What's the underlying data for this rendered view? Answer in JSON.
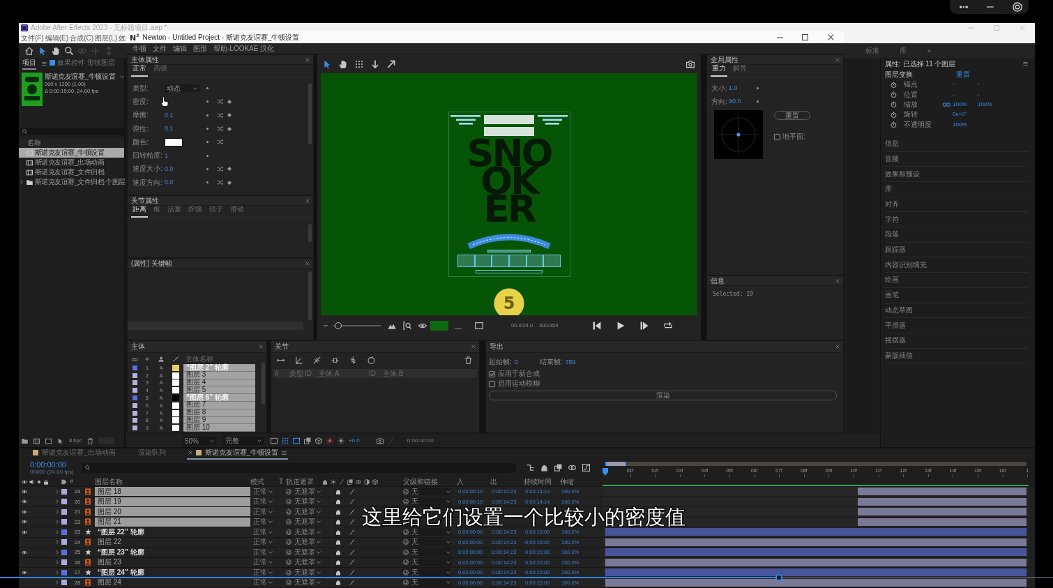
{
  "video_player": {
    "progress": {
      "level": 0.74
    }
  },
  "ae": {
    "title": "Adobe After Effects 2023 - 无标题项目.aep *",
    "menu": [
      "文件(F)",
      "编辑(E)",
      "合成(C)",
      "图层(L)",
      "效"
    ],
    "tools": [
      {
        "kind": "home",
        "selected": false,
        "disabled": false
      },
      {
        "kind": "select",
        "selected": true,
        "disabled": false
      },
      {
        "kind": "hand",
        "selected": false,
        "disabled": false
      },
      {
        "kind": "zoom",
        "selected": false,
        "disabled": false
      },
      {
        "kind": "orbit",
        "selected": false,
        "disabled": true
      },
      {
        "kind": "move",
        "selected": false,
        "disabled": true
      },
      {
        "kind": "dolly",
        "selected": false,
        "disabled": true
      }
    ],
    "workspaces": [
      {
        "label": "标准",
        "selected": false
      },
      {
        "label": "库",
        "selected": false
      }
    ],
    "workspace_more": "»",
    "project": {
      "tabs": [
        {
          "label": "项目",
          "selected": true
        },
        {
          "label": "效果控件 形状图层",
          "selected": false
        }
      ],
      "comp": {
        "name": "斯诺克友谊赛_牛顿设置",
        "size": "900 x 1200 (1.00)",
        "duration": "Δ 0:00:15:00, 24.00 fps"
      },
      "column": "名称",
      "items": [
        {
          "kind": "comp",
          "name": "斯诺克友谊赛_牛顿设置",
          "selected": true
        },
        {
          "kind": "comp",
          "name": "斯诺克友谊赛_出场动画",
          "selected": false
        },
        {
          "kind": "comp",
          "name": "斯诺克友谊赛_文件归档",
          "selected": false
        },
        {
          "kind": "folder",
          "name": "斯诺克友谊赛_文件归档 个图层",
          "selected": false
        }
      ],
      "bpc": "8 bpc"
    },
    "viewer_footer": {
      "zoom": "50%",
      "resolution": "完整",
      "exposure": "+0.0",
      "time": "0:00:00:00"
    },
    "properties": {
      "title": "属性: 已选择 11 个图层",
      "group": "图层变换",
      "reset": "重置",
      "rows": [
        {
          "label": "锚点",
          "linked": false,
          "values": [
            "-",
            "-"
          ]
        },
        {
          "label": "位置",
          "linked": false,
          "values": [
            "-",
            "-"
          ]
        },
        {
          "label": "缩放",
          "linked": true,
          "values": [
            "100%",
            "100%"
          ]
        },
        {
          "label": "旋转",
          "linked": false,
          "values": [
            "0x+0°"
          ]
        },
        {
          "label": "不透明度",
          "linked": false,
          "values": [
            "100%"
          ]
        }
      ],
      "panels": [
        "信息",
        "音频",
        "效果和预设",
        "库",
        "对齐",
        "字符",
        "段落",
        "跟踪器",
        "内容识别填充",
        "绘画",
        "画笔",
        "动态草图",
        "平滑器",
        "摇摆器",
        "蒙版插值"
      ]
    },
    "timeline": {
      "tabs": [
        {
          "label": "斯诺克友谊赛_出场动画",
          "selected": false,
          "kind": "comp"
        },
        {
          "label": "渲染队列",
          "selected": false,
          "kind": "queue"
        },
        {
          "label": "斯诺克友谊赛_牛顿设置",
          "selected": true,
          "kind": "comp"
        }
      ],
      "time": "0:00:00:00",
      "frame_info": "00000 (24.00 fps)",
      "columns": {
        "number": "#",
        "name": "图层名称",
        "mode": "模式",
        "t": "T",
        "matte": "轨道遮罩",
        "parent": "父级和链接",
        "in": "入",
        "out": "出",
        "duration": "持续时间",
        "stretch": "伸缩"
      },
      "ruler": [
        "01f",
        "02f",
        "03f",
        "04f",
        "05f",
        "06f",
        "07f",
        "08f",
        "09f",
        "10f",
        "11f",
        "12f",
        "13f",
        "14f",
        "15f",
        "16f",
        "1"
      ],
      "layers": [
        {
          "num": "19",
          "kind": "vector",
          "name": "图层 18",
          "selected": true,
          "visible": true,
          "color": "#a9aadc",
          "mode": "正常",
          "matte": "无遮罩",
          "parent": "无",
          "in": "0:00:00:10",
          "out": "0:00:14:23",
          "duration": "0:00:14:14",
          "stretch": "100.0%",
          "bar": {
            "level": 0.4
          }
        },
        {
          "num": "20",
          "kind": "vector",
          "name": "图层 19",
          "selected": true,
          "visible": true,
          "color": "#a9aadc",
          "mode": "正常",
          "matte": "无遮罩",
          "parent": "无",
          "in": "0:00:00:10",
          "out": "0:00:14:23",
          "duration": "0:00:14:14",
          "stretch": "100.0%",
          "bar": {
            "level": 0.4
          }
        },
        {
          "num": "21",
          "kind": "vector",
          "name": "图层 20",
          "selected": true,
          "visible": true,
          "color": "#a9aadc",
          "mode": "正常",
          "matte": "无遮罩",
          "bar": {
            "level": 0.4
          }
        },
        {
          "num": "22",
          "kind": "vector",
          "name": "图层 21",
          "selected": true,
          "visible": true,
          "color": "#a9aadc",
          "mode": "正常",
          "matte": "无遮罩",
          "bar": {
            "level": 0.4
          }
        },
        {
          "num": "23",
          "kind": "shape",
          "name": "“图层 22” 轮廓",
          "selected": false,
          "visible": true,
          "color": "#5b6fe0",
          "mode": "正常",
          "matte": "无遮罩",
          "parent": "无",
          "in": "0:00:00:00",
          "out": "0:00:14:23",
          "duration": "0:00:15:00",
          "stretch": "100.0%",
          "bar": {
            "level": 1
          }
        },
        {
          "num": "24",
          "kind": "vector",
          "name": "图层 22",
          "selected": false,
          "visible": false,
          "color": "#a9aadc",
          "mode": "正常",
          "matte": "无遮罩",
          "parent": "无",
          "in": "0:00:00:00",
          "out": "0:00:14:23",
          "duration": "0:00:15:00",
          "stretch": "100.0%",
          "bar": {
            "level": 1
          }
        },
        {
          "num": "25",
          "kind": "shape",
          "name": "“图层 23” 轮廓",
          "selected": false,
          "visible": true,
          "color": "#5b6fe0",
          "mode": "正常",
          "matte": "无遮罩",
          "parent": "无",
          "in": "0:00:00:00",
          "out": "0:00:14:23",
          "duration": "0:00:15:00",
          "stretch": "100.0%",
          "bar": {
            "level": 1
          }
        },
        {
          "num": "26",
          "kind": "vector",
          "name": "图层 23",
          "selected": false,
          "visible": false,
          "color": "#a9aadc",
          "mode": "正常",
          "matte": "无遮罩",
          "parent": "无",
          "in": "0:00:00:00",
          "out": "0:00:14:23",
          "duration": "0:00:15:00",
          "stretch": "100.0%",
          "bar": {
            "level": 1
          }
        },
        {
          "num": "27",
          "kind": "shape",
          "name": "“图层 24” 轮廓",
          "selected": false,
          "visible": true,
          "color": "#5b6fe0",
          "mode": "正常",
          "matte": "无遮罩",
          "parent": "无",
          "in": "0:00:00:00",
          "out": "0:00:14:23",
          "duration": "0:00:15:00",
          "stretch": "100.0%",
          "bar": {
            "level": 1
          }
        },
        {
          "num": "28",
          "kind": "vector",
          "name": "图层 24",
          "selected": false,
          "visible": false,
          "color": "#a9aadc",
          "mode": "正常",
          "matte": "无遮罩",
          "parent": "无",
          "in": "0:00:00:00",
          "out": "0:00:14:23",
          "duration": "0:00:15:00",
          "stretch": "100.0%",
          "bar": {
            "level": 1
          }
        }
      ]
    }
  },
  "newton": {
    "logo": "N$^{3}$",
    "title": "Newton - Untitled Project - 斯诺克友谊赛_牛顿设置",
    "menu": [
      "牛顿",
      "文件",
      "编辑",
      "图形",
      "帮助-LOOKAE 汉化"
    ],
    "body_props": {
      "title": "主体属性",
      "tabs": [
        {
          "label": "正常",
          "selected": true
        },
        {
          "label": "高级",
          "selected": false
        }
      ],
      "rows": [
        {
          "kind": "dropdown",
          "label": "类型:",
          "value": "动态",
          "shuffle": false,
          "keyframe": false
        },
        {
          "kind": "number",
          "label": "密度:",
          "shuffle": true,
          "keyframe": true
        },
        {
          "kind": "number",
          "label": "摩擦:",
          "value": "0.1",
          "shuffle": true,
          "keyframe": true
        },
        {
          "kind": "number",
          "label": "弹性:",
          "value": "0.1",
          "shuffle": true,
          "keyframe": true
        },
        {
          "kind": "color",
          "label": "颜色:",
          "color": "#ffffff",
          "shuffle": true,
          "keyframe": false
        },
        {
          "kind": "number",
          "label": "回转精度:",
          "value": "1",
          "shuffle": false,
          "keyframe": false
        },
        {
          "kind": "number",
          "label": "速度大小:",
          "value": "0.0",
          "shuffle": true,
          "keyframe": true
        },
        {
          "kind": "number",
          "label": "速度方向:",
          "value": "0.0",
          "shuffle": true,
          "keyframe": true
        }
      ]
    },
    "joint_props": {
      "title": "关节属性",
      "tabs": [
        {
          "label": "距离",
          "selected": true
        },
        {
          "label": "枢",
          "selected": false
        },
        {
          "label": "活塞",
          "selected": false
        },
        {
          "label": "焊接",
          "selected": false
        },
        {
          "label": "轮子",
          "selected": false
        },
        {
          "label": "滑动",
          "selected": false
        }
      ]
    },
    "keyframes": {
      "title": "(属性) 关键帧"
    },
    "viewer": {
      "tools": [
        {
          "kind": "select",
          "selected": true
        },
        {
          "kind": "hand",
          "selected": false
        },
        {
          "kind": "grid",
          "selected": false
        },
        {
          "kind": "pin",
          "selected": false
        },
        {
          "kind": "arrow",
          "selected": false
        }
      ],
      "poster": {
        "lines": [
          "SNO",
          "OK",
          "ER"
        ],
        "ball": "5"
      },
      "zoom": {
        "level": 0.1
      },
      "fps": "00.0/24.0",
      "frame": "000/359"
    },
    "global_props": {
      "title": "全局属性",
      "tabs": [
        {
          "label": "重力",
          "selected": true
        },
        {
          "label": "解算",
          "selected": false
        }
      ],
      "rows": [
        {
          "label": "大小:",
          "value": "1.0"
        },
        {
          "label": "方向:",
          "value": "90.0"
        }
      ],
      "reset": "重置",
      "checkbox": {
        "label": "地平面:",
        "checked": false
      }
    },
    "info": {
      "title": "信息",
      "text": "Selected: 19"
    },
    "bodies": {
      "title": "主体",
      "columns": {
        "number": "#",
        "name": "主体名称"
      },
      "rows": [
        {
          "num": "1",
          "label": {
            "color": "#5b6fe0"
          },
          "group": "A",
          "color": "#e6d35a",
          "kind": "shape",
          "name": "“图层 2” 轮廓",
          "selected": true
        },
        {
          "num": "2",
          "label": {
            "color": "#b3b4de"
          },
          "group": "A",
          "color": "#ffffff",
          "kind": "vector",
          "name": "图层 3",
          "selected": true
        },
        {
          "num": "3",
          "label": {
            "color": "#b3b4de"
          },
          "group": "A",
          "color": "#ffffff",
          "kind": "vector",
          "name": "图层 4",
          "selected": true
        },
        {
          "num": "4",
          "label": {
            "color": "#b3b4de"
          },
          "group": "A",
          "color": "#ffffff",
          "kind": "vector",
          "name": "图层 5",
          "selected": true
        },
        {
          "num": "5",
          "label": {
            "color": "#5b6fe0"
          },
          "group": "A",
          "color": "#000000",
          "kind": "shape",
          "name": "“图层 6” 轮廓",
          "selected": true
        },
        {
          "num": "6",
          "label": {
            "color": "#b3b4de"
          },
          "group": "A",
          "color": "#ffffff",
          "kind": "vector",
          "name": "图层 7",
          "selected": true
        },
        {
          "num": "7",
          "label": {
            "color": "#b3b4de"
          },
          "group": "A",
          "color": "#ffffff",
          "kind": "vector",
          "name": "图层 8",
          "selected": true
        },
        {
          "num": "8",
          "label": {
            "color": "#b3b4de"
          },
          "group": "A",
          "color": "#ffffff",
          "kind": "vector",
          "name": "图层 9",
          "selected": true
        },
        {
          "num": "9",
          "label": {
            "color": "#b3b4de"
          },
          "group": "A",
          "color": "#ffffff",
          "kind": "vector",
          "name": "图层 10",
          "selected": true
        }
      ]
    },
    "joints": {
      "title": "关节",
      "columns": [
        "#",
        "类型",
        "ID",
        "主体 A",
        "ID",
        "主体 B"
      ]
    },
    "export": {
      "title": "导出",
      "start": {
        "label": "起始帧:",
        "value": "0"
      },
      "end": {
        "label": "结束帧:",
        "value": "359"
      },
      "options": [
        {
          "label": "应用于新合成",
          "checked": true
        },
        {
          "label": "启用运动模糊",
          "checked": false
        }
      ],
      "render": "渲染"
    }
  },
  "subtitle": "这里给它们设置一个比较小的密度值"
}
